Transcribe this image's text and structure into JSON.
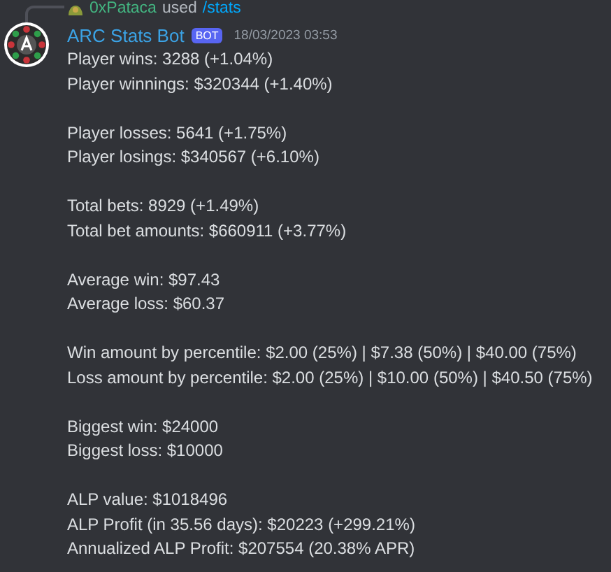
{
  "reply": {
    "user": "0xPataca",
    "verb": "used",
    "command": "/stats"
  },
  "message": {
    "author": "ARC Stats Bot",
    "badge": "BOT",
    "timestamp": "18/03/2023 03:53",
    "groups": [
      [
        "Player wins: 3288 (+1.04%)",
        "Player winnings: $320344 (+1.40%)"
      ],
      [
        "Player losses: 5641 (+1.75%)",
        "Player losings: $340567 (+6.10%)"
      ],
      [
        "Total bets: 8929 (+1.49%)",
        "Total bet amounts: $660911 (+3.77%)"
      ],
      [
        "Average win: $97.43",
        "Average loss: $60.37"
      ],
      [
        "Win amount by percentile: $2.00 (25%) | $7.38 (50%) | $40.00 (75%)",
        "Loss amount by percentile: $2.00 (25%) | $10.00 (50%) | $40.50 (75%)"
      ],
      [
        "Biggest win: $24000",
        "Biggest loss: $10000"
      ],
      [
        "ALP value: $1018496",
        "ALP Profit (in 35.56 days): $20223 (+299.21%)",
        "Annualized ALP Profit: $207554 (20.38% APR)"
      ]
    ]
  }
}
